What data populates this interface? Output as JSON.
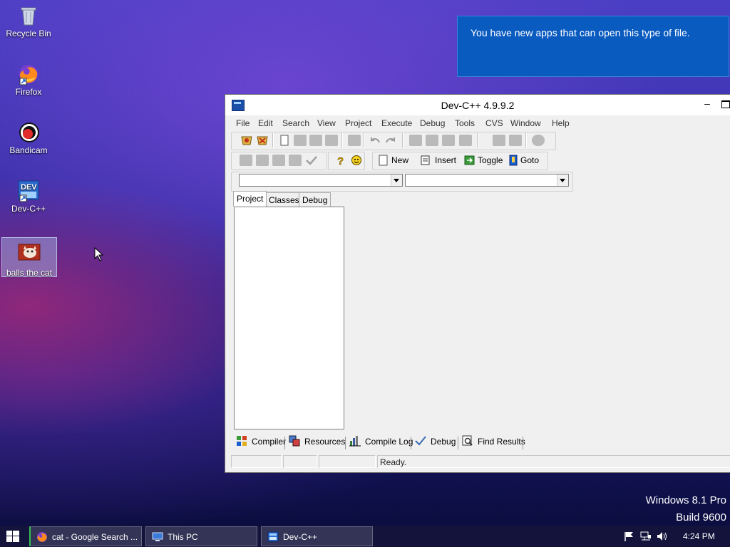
{
  "desktop": {
    "icons": [
      {
        "label": "Recycle Bin",
        "icon": "recycle-bin-icon"
      },
      {
        "label": "Firefox",
        "icon": "firefox-icon"
      },
      {
        "label": "Bandicam",
        "icon": "bandicam-icon"
      },
      {
        "label": "Dev-C++",
        "icon": "devcpp-icon"
      },
      {
        "label": "balls the cat",
        "icon": "image-file-icon"
      }
    ]
  },
  "notification": {
    "text": "You have new apps that can open this type of file."
  },
  "window": {
    "title": "Dev-C++ 4.9.9.2",
    "minimize": "–",
    "menu": [
      "File",
      "Edit",
      "Search",
      "View",
      "Project",
      "Execute",
      "Debug",
      "Tools",
      "CVS",
      "Window",
      "Help"
    ],
    "toolbar2": {
      "new_label": "New",
      "insert_label": "Insert",
      "toggle_label": "Toggle",
      "goto_label": "Goto"
    },
    "left_tabs": [
      "Project",
      "Classes",
      "Debug"
    ],
    "bottom_tabs": [
      "Compiler",
      "Resources",
      "Compile Log",
      "Debug",
      "Find Results"
    ],
    "status": {
      "text": "Ready."
    }
  },
  "watermark": {
    "line1": "Windows 8.1 Pro",
    "line2": "Build 9600"
  },
  "taskbar": {
    "buttons": [
      {
        "label": "cat - Google Search ...",
        "icon": "firefox-icon"
      },
      {
        "label": "This PC",
        "icon": "this-pc-icon"
      },
      {
        "label": "Dev-C++",
        "icon": "devcpp-icon"
      }
    ],
    "clock": "4:24 PM"
  },
  "colors": {
    "toast_bg": "#0a5bc0",
    "window_bg": "#f0f0f0",
    "taskbar_bg": "#14143c"
  }
}
